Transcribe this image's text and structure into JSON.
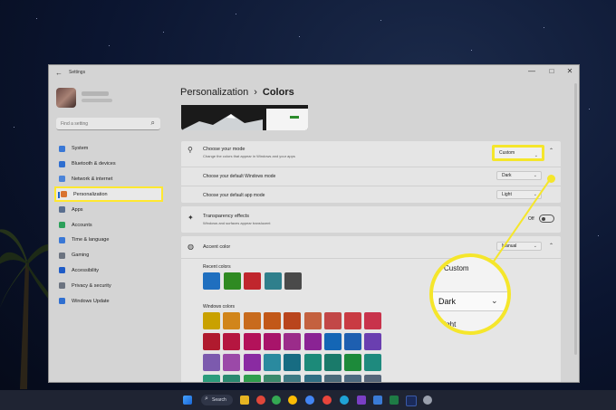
{
  "window": {
    "title": "Settings",
    "back": "←",
    "controls": [
      "—",
      "□",
      "✕"
    ]
  },
  "search": {
    "placeholder": "Find a setting",
    "icon": "search-icon"
  },
  "nav": [
    {
      "label": "System",
      "icon": "system-icon",
      "color": "#3a78d6"
    },
    {
      "label": "Bluetooth & devices",
      "icon": "bluetooth-icon",
      "color": "#2f6fd0"
    },
    {
      "label": "Network & internet",
      "icon": "wifi-icon",
      "color": "#4b84d9"
    },
    {
      "label": "Personalization",
      "icon": "pen-icon",
      "color": "#d9732f",
      "selected": true
    },
    {
      "label": "Apps",
      "icon": "apps-icon",
      "color": "#5a6f8f"
    },
    {
      "label": "Accounts",
      "icon": "accounts-icon",
      "color": "#2ca05a"
    },
    {
      "label": "Time & language",
      "icon": "time-icon",
      "color": "#3a78d6"
    },
    {
      "label": "Gaming",
      "icon": "gaming-icon",
      "color": "#6b7380"
    },
    {
      "label": "Accessibility",
      "icon": "accessibility-icon",
      "color": "#1f5cc7"
    },
    {
      "label": "Privacy & security",
      "icon": "shield-icon",
      "color": "#6b7380"
    },
    {
      "label": "Windows Update",
      "icon": "update-icon",
      "color": "#2f6fd0"
    }
  ],
  "breadcrumb": {
    "parent": "Personalization",
    "separator": "›",
    "current": "Colors"
  },
  "mode": {
    "title": "Choose your mode",
    "subtitle": "Change the colors that appear in Windows and your apps",
    "value": "Custom",
    "windows_mode_label": "Choose your default Windows mode",
    "windows_mode_value": "Dark",
    "app_mode_label": "Choose your default app mode",
    "app_mode_value": "Light"
  },
  "transparency": {
    "title": "Transparency effects",
    "subtitle": "Windows and surfaces appear translucent",
    "state": "Off"
  },
  "accent": {
    "title": "Accent color",
    "value": "Manual",
    "recent_label": "Recent colors",
    "recent": [
      "#1f6fbf",
      "#2f8a22",
      "#c0262d",
      "#2f7f8c",
      "#4a4a4a"
    ],
    "windows_label": "Windows colors",
    "windows_rows": [
      [
        "#c9a100",
        "#d1851a",
        "#c86b1d",
        "#c25818",
        "#b9451d",
        "#c4613f",
        "#c24747",
        "#c93b43",
        "#c8334b"
      ],
      [
        "#b01a2e",
        "#b51640",
        "#b3125a",
        "#a8146a",
        "#9b2c8a",
        "#8a2394",
        "#1466b5",
        "#1e5fb0",
        "#6a3fb0"
      ],
      [
        "#7c5aae",
        "#9b49a8",
        "#8a2ba2",
        "#2a8a9f",
        "#176c82",
        "#1c8a79",
        "#1a7a6a",
        "#1d8a3a",
        "#1e8a7e"
      ],
      [
        "#2b9c7c",
        "#2a8a70",
        "#2f9e4d",
        "#3a8a6c",
        "#3d7a84",
        "#2f6f84",
        "#4a6a7a",
        "#4d6a80",
        "#56667a"
      ]
    ]
  },
  "callout": {
    "above": "Custom",
    "selected": "Dark",
    "chevron": "⌄",
    "below": "Light"
  },
  "taskbar": {
    "search_label": "Search"
  }
}
